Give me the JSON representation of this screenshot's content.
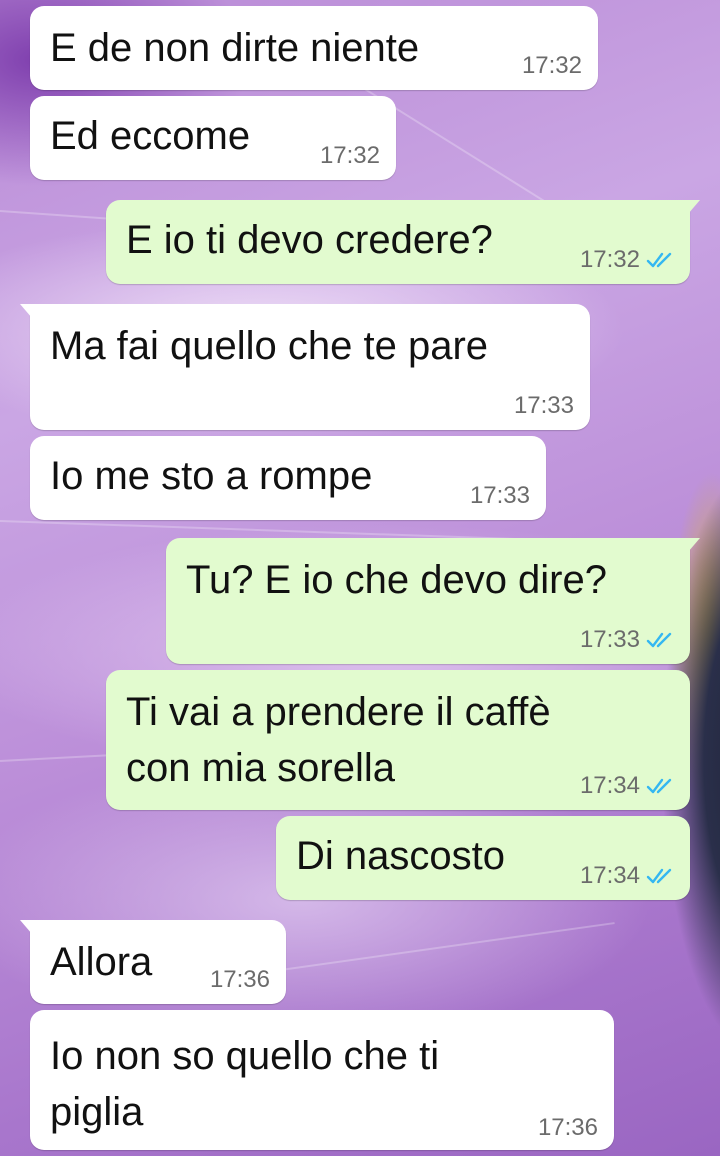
{
  "colors": {
    "incoming_bubble": "#ffffff",
    "outgoing_bubble": "#e2fbcf",
    "read_ticks": "#34b7f1",
    "timestamp": "#6b6b6b"
  },
  "messages": [
    {
      "direction": "in",
      "lines": [
        "E de non dirte niente"
      ],
      "time": "17:32"
    },
    {
      "direction": "in",
      "lines": [
        "Ed eccome"
      ],
      "time": "17:32"
    },
    {
      "direction": "out",
      "lines": [
        "E io ti devo credere?"
      ],
      "time": "17:32",
      "status": "read-double-check-icon"
    },
    {
      "direction": "in",
      "lines": [
        "Ma fai quello che te pare"
      ],
      "time": "17:33"
    },
    {
      "direction": "in",
      "lines": [
        "Io me sto a rompe"
      ],
      "time": "17:33"
    },
    {
      "direction": "out",
      "lines": [
        "Tu? E io che devo dire?"
      ],
      "time": "17:33",
      "status": "read-double-check-icon"
    },
    {
      "direction": "out",
      "lines": [
        "Ti vai a prendere il caffè",
        "con mia sorella"
      ],
      "time": "17:34",
      "status": "read-double-check-icon"
    },
    {
      "direction": "out",
      "lines": [
        "Di nascosto"
      ],
      "time": "17:34",
      "status": "read-double-check-icon"
    },
    {
      "direction": "in",
      "lines": [
        "Allora"
      ],
      "time": "17:36"
    },
    {
      "direction": "in",
      "lines": [
        "Io non so quello che ti",
        "piglia"
      ],
      "time": "17:36"
    }
  ]
}
